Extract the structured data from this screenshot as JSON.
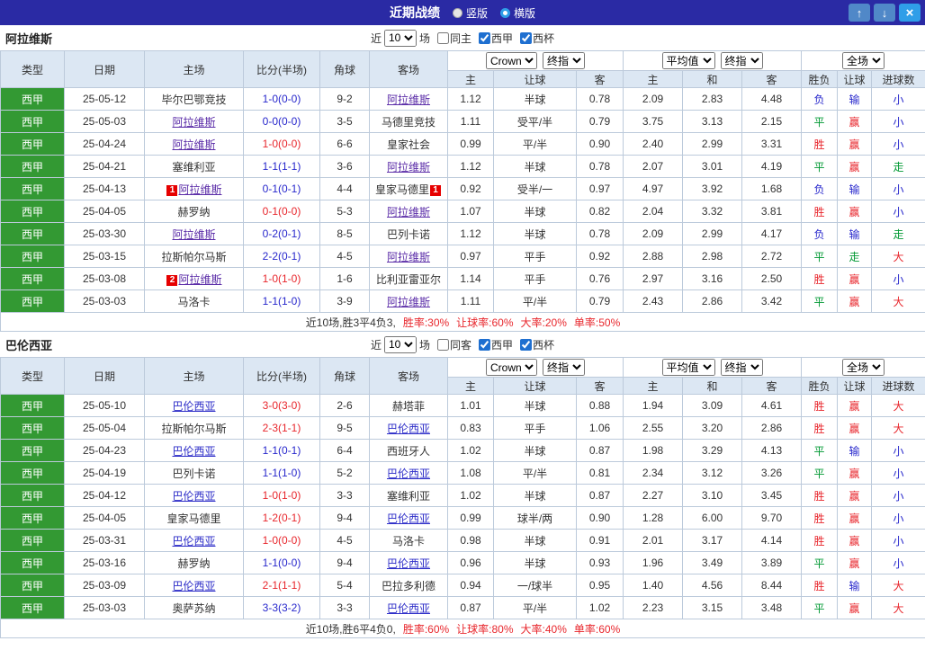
{
  "topbar": {
    "title": "近期战绩",
    "radio_vertical": "竖版",
    "radio_horizontal": "横版",
    "up_icon": "↑",
    "down_icon": "↓",
    "close_icon": "×"
  },
  "colors": {
    "titlebar_navy": "#2a2aa4",
    "header_bg": "#dce7f3",
    "border": "#bccadb",
    "league_green": "#339933",
    "win_red": "#e8262c",
    "loss_blue": "#2727cc",
    "push_green": "#009933"
  },
  "filter": {
    "near": "近",
    "count": "10",
    "games": "场"
  },
  "selects": {
    "company": "Crown",
    "final1": "终指",
    "average": "平均值",
    "final2": "终指",
    "scope": "全场"
  },
  "columns": [
    "类型",
    "日期",
    "主场",
    "比分(半场)",
    "角球",
    "客场",
    "主",
    "让球",
    "客",
    "主",
    "和",
    "客",
    "胜负",
    "让球",
    "进球数"
  ],
  "sections": [
    {
      "team": "阿拉维斯",
      "focus_color": "#5b2da8",
      "checkboxes": [
        {
          "label": "同主",
          "checked": false
        },
        {
          "label": "西甲",
          "checked": true
        },
        {
          "label": "西杯",
          "checked": true
        }
      ],
      "rows": [
        {
          "lg": "西甲",
          "dt": "25-05-12",
          "home": "毕尔巴鄂竞技",
          "hf": false,
          "hb": "",
          "sc": "1-0(0-0)",
          "res": "loss",
          "cn": "9-2",
          "away": "阿拉维斯",
          "af": true,
          "ab": "",
          "ah": [
            "1.12",
            "半球",
            "0.78"
          ],
          "eu": [
            "2.09",
            "2.83",
            "4.48"
          ],
          "w": "负",
          "hd": "输",
          "g": "小"
        },
        {
          "lg": "西甲",
          "dt": "25-05-03",
          "home": "阿拉维斯",
          "hf": true,
          "hb": "",
          "sc": "0-0(0-0)",
          "res": "draw",
          "cn": "3-5",
          "away": "马德里竞技",
          "af": false,
          "ab": "",
          "ah": [
            "1.11",
            "受平/半",
            "0.79"
          ],
          "eu": [
            "3.75",
            "3.13",
            "2.15"
          ],
          "w": "平",
          "hd": "赢",
          "g": "小"
        },
        {
          "lg": "西甲",
          "dt": "25-04-24",
          "home": "阿拉维斯",
          "hf": true,
          "hb": "",
          "sc": "1-0(0-0)",
          "res": "win",
          "cn": "6-6",
          "away": "皇家社会",
          "af": false,
          "ab": "",
          "ah": [
            "0.99",
            "平/半",
            "0.90"
          ],
          "eu": [
            "2.40",
            "2.99",
            "3.31"
          ],
          "w": "胜",
          "hd": "赢",
          "g": "小"
        },
        {
          "lg": "西甲",
          "dt": "25-04-21",
          "home": "塞维利亚",
          "hf": false,
          "hb": "",
          "sc": "1-1(1-1)",
          "res": "draw",
          "cn": "3-6",
          "away": "阿拉维斯",
          "af": true,
          "ab": "",
          "ah": [
            "1.12",
            "半球",
            "0.78"
          ],
          "eu": [
            "2.07",
            "3.01",
            "4.19"
          ],
          "w": "平",
          "hd": "赢",
          "g": "走"
        },
        {
          "lg": "西甲",
          "dt": "25-04-13",
          "home": "阿拉维斯",
          "hf": true,
          "hb": "1",
          "sc": "0-1(0-1)",
          "res": "loss",
          "cn": "4-4",
          "away": "皇家马德里",
          "af": false,
          "ab": "1",
          "ah": [
            "0.92",
            "受半/一",
            "0.97"
          ],
          "eu": [
            "4.97",
            "3.92",
            "1.68"
          ],
          "w": "负",
          "hd": "输",
          "g": "小"
        },
        {
          "lg": "西甲",
          "dt": "25-04-05",
          "home": "赫罗纳",
          "hf": false,
          "hb": "",
          "sc": "0-1(0-0)",
          "res": "win",
          "cn": "5-3",
          "away": "阿拉维斯",
          "af": true,
          "ab": "",
          "ah": [
            "1.07",
            "半球",
            "0.82"
          ],
          "eu": [
            "2.04",
            "3.32",
            "3.81"
          ],
          "w": "胜",
          "hd": "赢",
          "g": "小"
        },
        {
          "lg": "西甲",
          "dt": "25-03-30",
          "home": "阿拉维斯",
          "hf": true,
          "hb": "",
          "sc": "0-2(0-1)",
          "res": "loss",
          "cn": "8-5",
          "away": "巴列卡诺",
          "af": false,
          "ab": "",
          "ah": [
            "1.12",
            "半球",
            "0.78"
          ],
          "eu": [
            "2.09",
            "2.99",
            "4.17"
          ],
          "w": "负",
          "hd": "输",
          "g": "走"
        },
        {
          "lg": "西甲",
          "dt": "25-03-15",
          "home": "拉斯帕尔马斯",
          "hf": false,
          "hb": "",
          "sc": "2-2(0-1)",
          "res": "draw",
          "cn": "4-5",
          "away": "阿拉维斯",
          "af": true,
          "ab": "",
          "ah": [
            "0.97",
            "平手",
            "0.92"
          ],
          "eu": [
            "2.88",
            "2.98",
            "2.72"
          ],
          "w": "平",
          "hd": "走",
          "g": "大"
        },
        {
          "lg": "西甲",
          "dt": "25-03-08",
          "home": "阿拉维斯",
          "hf": true,
          "hb": "2",
          "sc": "1-0(1-0)",
          "res": "win",
          "cn": "1-6",
          "away": "比利亚雷亚尔",
          "af": false,
          "ab": "",
          "ah": [
            "1.14",
            "平手",
            "0.76"
          ],
          "eu": [
            "2.97",
            "3.16",
            "2.50"
          ],
          "w": "胜",
          "hd": "赢",
          "g": "小"
        },
        {
          "lg": "西甲",
          "dt": "25-03-03",
          "home": "马洛卡",
          "hf": false,
          "hb": "",
          "sc": "1-1(1-0)",
          "res": "draw",
          "cn": "3-9",
          "away": "阿拉维斯",
          "af": true,
          "ab": "",
          "ah": [
            "1.11",
            "平/半",
            "0.79"
          ],
          "eu": [
            "2.43",
            "2.86",
            "3.42"
          ],
          "w": "平",
          "hd": "赢",
          "g": "大"
        }
      ],
      "summary_lead": "近10场,胜3平4负3,",
      "summary_stats": [
        "胜率:30%",
        "让球率:60%",
        "大率:20%",
        "单率:50%"
      ]
    },
    {
      "team": "巴伦西亚",
      "focus_color": "#2d2dc8",
      "checkboxes": [
        {
          "label": "同客",
          "checked": false
        },
        {
          "label": "西甲",
          "checked": true
        },
        {
          "label": "西杯",
          "checked": true
        }
      ],
      "rows": [
        {
          "lg": "西甲",
          "dt": "25-05-10",
          "home": "巴伦西亚",
          "hf": true,
          "hb": "",
          "sc": "3-0(3-0)",
          "res": "win",
          "cn": "2-6",
          "away": "赫塔菲",
          "af": false,
          "ab": "",
          "ah": [
            "1.01",
            "半球",
            "0.88"
          ],
          "eu": [
            "1.94",
            "3.09",
            "4.61"
          ],
          "w": "胜",
          "hd": "赢",
          "g": "大"
        },
        {
          "lg": "西甲",
          "dt": "25-05-04",
          "home": "拉斯帕尔马斯",
          "hf": false,
          "hb": "",
          "sc": "2-3(1-1)",
          "res": "win",
          "cn": "9-5",
          "away": "巴伦西亚",
          "af": true,
          "ab": "",
          "ah": [
            "0.83",
            "平手",
            "1.06"
          ],
          "eu": [
            "2.55",
            "3.20",
            "2.86"
          ],
          "w": "胜",
          "hd": "赢",
          "g": "大"
        },
        {
          "lg": "西甲",
          "dt": "25-04-23",
          "home": "巴伦西亚",
          "hf": true,
          "hb": "",
          "sc": "1-1(0-1)",
          "res": "draw",
          "cn": "6-4",
          "away": "西班牙人",
          "af": false,
          "ab": "",
          "ah": [
            "1.02",
            "半球",
            "0.87"
          ],
          "eu": [
            "1.98",
            "3.29",
            "4.13"
          ],
          "w": "平",
          "hd": "输",
          "g": "小"
        },
        {
          "lg": "西甲",
          "dt": "25-04-19",
          "home": "巴列卡诺",
          "hf": false,
          "hb": "",
          "sc": "1-1(1-0)",
          "res": "draw",
          "cn": "5-2",
          "away": "巴伦西亚",
          "af": true,
          "ab": "",
          "ah": [
            "1.08",
            "平/半",
            "0.81"
          ],
          "eu": [
            "2.34",
            "3.12",
            "3.26"
          ],
          "w": "平",
          "hd": "赢",
          "g": "小"
        },
        {
          "lg": "西甲",
          "dt": "25-04-12",
          "home": "巴伦西亚",
          "hf": true,
          "hb": "",
          "sc": "1-0(1-0)",
          "res": "win",
          "cn": "3-3",
          "away": "塞维利亚",
          "af": false,
          "ab": "",
          "ah": [
            "1.02",
            "半球",
            "0.87"
          ],
          "eu": [
            "2.27",
            "3.10",
            "3.45"
          ],
          "w": "胜",
          "hd": "赢",
          "g": "小"
        },
        {
          "lg": "西甲",
          "dt": "25-04-05",
          "home": "皇家马德里",
          "hf": false,
          "hb": "",
          "sc": "1-2(0-1)",
          "res": "win",
          "cn": "9-4",
          "away": "巴伦西亚",
          "af": true,
          "ab": "",
          "ah": [
            "0.99",
            "球半/两",
            "0.90"
          ],
          "eu": [
            "1.28",
            "6.00",
            "9.70"
          ],
          "w": "胜",
          "hd": "赢",
          "g": "小"
        },
        {
          "lg": "西甲",
          "dt": "25-03-31",
          "home": "巴伦西亚",
          "hf": true,
          "hb": "",
          "sc": "1-0(0-0)",
          "res": "win",
          "cn": "4-5",
          "away": "马洛卡",
          "af": false,
          "ab": "",
          "ah": [
            "0.98",
            "半球",
            "0.91"
          ],
          "eu": [
            "2.01",
            "3.17",
            "4.14"
          ],
          "w": "胜",
          "hd": "赢",
          "g": "小"
        },
        {
          "lg": "西甲",
          "dt": "25-03-16",
          "home": "赫罗纳",
          "hf": false,
          "hb": "",
          "sc": "1-1(0-0)",
          "res": "draw",
          "cn": "9-4",
          "away": "巴伦西亚",
          "af": true,
          "ab": "",
          "ah": [
            "0.96",
            "半球",
            "0.93"
          ],
          "eu": [
            "1.96",
            "3.49",
            "3.89"
          ],
          "w": "平",
          "hd": "赢",
          "g": "小"
        },
        {
          "lg": "西甲",
          "dt": "25-03-09",
          "home": "巴伦西亚",
          "hf": true,
          "hb": "",
          "sc": "2-1(1-1)",
          "res": "win",
          "cn": "5-4",
          "away": "巴拉多利德",
          "af": false,
          "ab": "",
          "ah": [
            "0.94",
            "一/球半",
            "0.95"
          ],
          "eu": [
            "1.40",
            "4.56",
            "8.44"
          ],
          "w": "胜",
          "hd": "输",
          "g": "大"
        },
        {
          "lg": "西甲",
          "dt": "25-03-03",
          "home": "奥萨苏纳",
          "hf": false,
          "hb": "",
          "sc": "3-3(3-2)",
          "res": "draw",
          "cn": "3-3",
          "away": "巴伦西亚",
          "af": true,
          "ab": "",
          "ah": [
            "0.87",
            "平/半",
            "1.02"
          ],
          "eu": [
            "2.23",
            "3.15",
            "3.48"
          ],
          "w": "平",
          "hd": "赢",
          "g": "大"
        }
      ],
      "summary_lead": "近10场,胜6平4负0,",
      "summary_stats": [
        "胜率:60%",
        "让球率:80%",
        "大率:40%",
        "单率:60%"
      ]
    }
  ]
}
